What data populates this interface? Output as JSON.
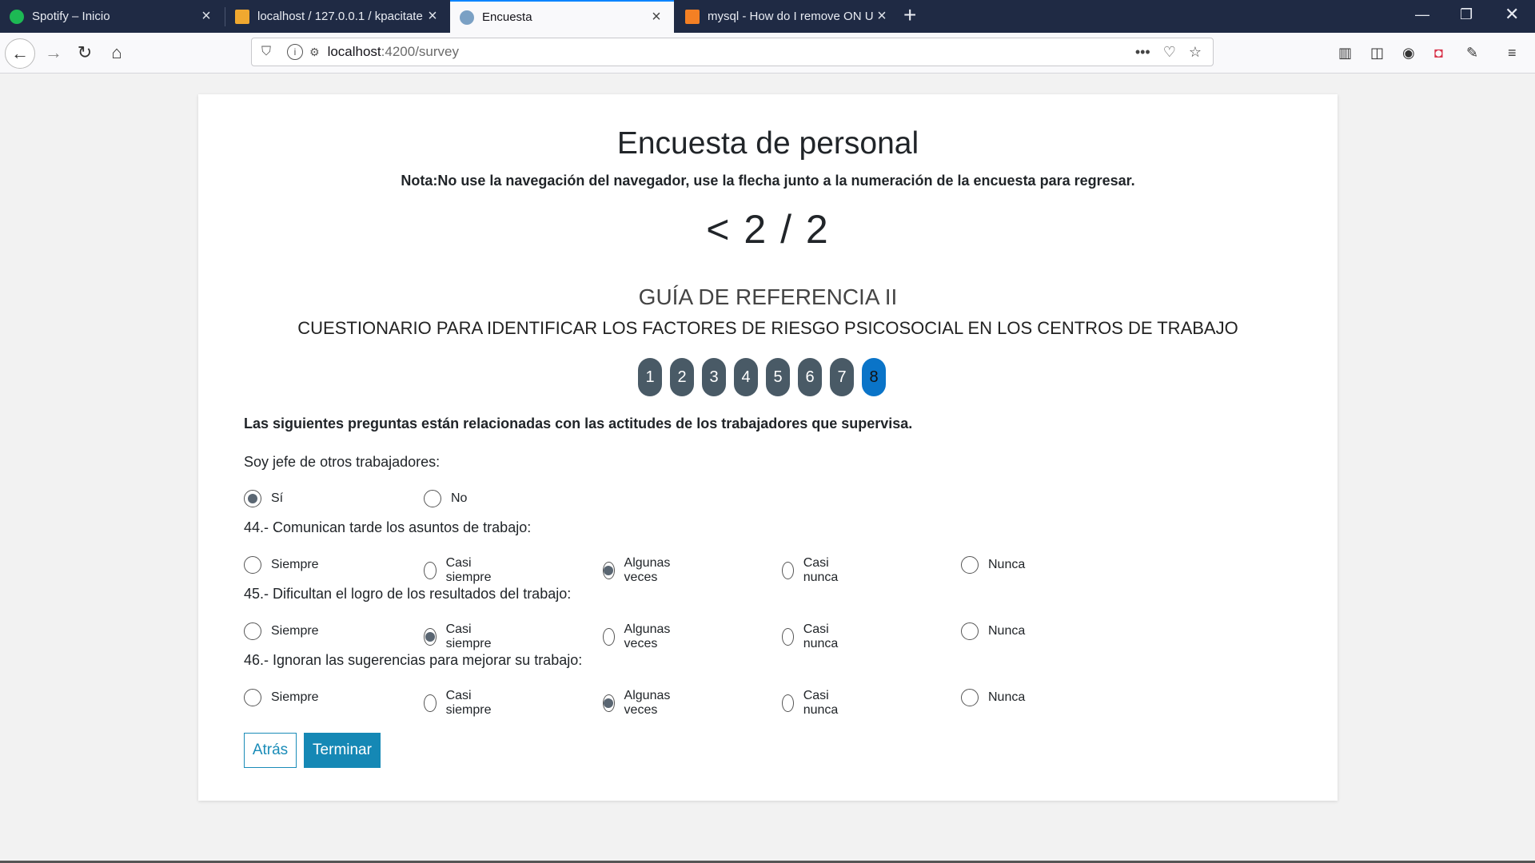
{
  "browser": {
    "tabs": [
      {
        "title": "Spotify – Inicio",
        "favicon_color": "#1db954"
      },
      {
        "title": "localhost / 127.0.0.1 / kpacitate",
        "favicon_color": "#f0a830"
      },
      {
        "title": "Encuesta",
        "favicon_color": "#7aa0c4"
      },
      {
        "title": "mysql - How do I remove ON U",
        "favicon_color": "#f48024"
      }
    ],
    "url_host": "localhost",
    "url_path": ":4200/survey"
  },
  "page": {
    "title": "Encuesta de personal",
    "note": "Nota:No use la navegación del navegador, use la flecha junto a la numeración de la encuesta para regresar.",
    "pager": "< 2 / 2",
    "guide": "GUÍA DE REFERENCIA II",
    "questionnaire": "CUESTIONARIO PARA IDENTIFICAR LOS FACTORES DE RIESGO PSICOSOCIAL EN LOS CENTROS DE TRABAJO",
    "steps": [
      "1",
      "2",
      "3",
      "4",
      "5",
      "6",
      "7",
      "8"
    ],
    "active_step": "8",
    "intro": "Las siguientes preguntas están relacionadas con las actitudes de los trabajadores que supervisa.",
    "boss_question": {
      "text": "Soy jefe de otros trabajadores:",
      "options": [
        "Sí",
        "No"
      ],
      "selected": "Sí"
    },
    "questions": [
      {
        "text": "44.- Comunican tarde los asuntos de trabajo:",
        "selected": "Algunas veces"
      },
      {
        "text": "45.- Dificultan el logro de los resultados del trabajo:",
        "selected": "Casi siempre"
      },
      {
        "text": "46.- Ignoran las sugerencias para mejorar su trabajo:",
        "selected": "Algunas veces"
      }
    ],
    "frequency_options": [
      "Siempre",
      "Casi siempre",
      "Algunas veces",
      "Casi nunca",
      "Nunca"
    ],
    "back_label": "Atrás",
    "finish_label": "Terminar"
  },
  "colors": {
    "accent": "#1588b5",
    "step_inactive": "#495a66",
    "step_active": "#0a74c8"
  }
}
